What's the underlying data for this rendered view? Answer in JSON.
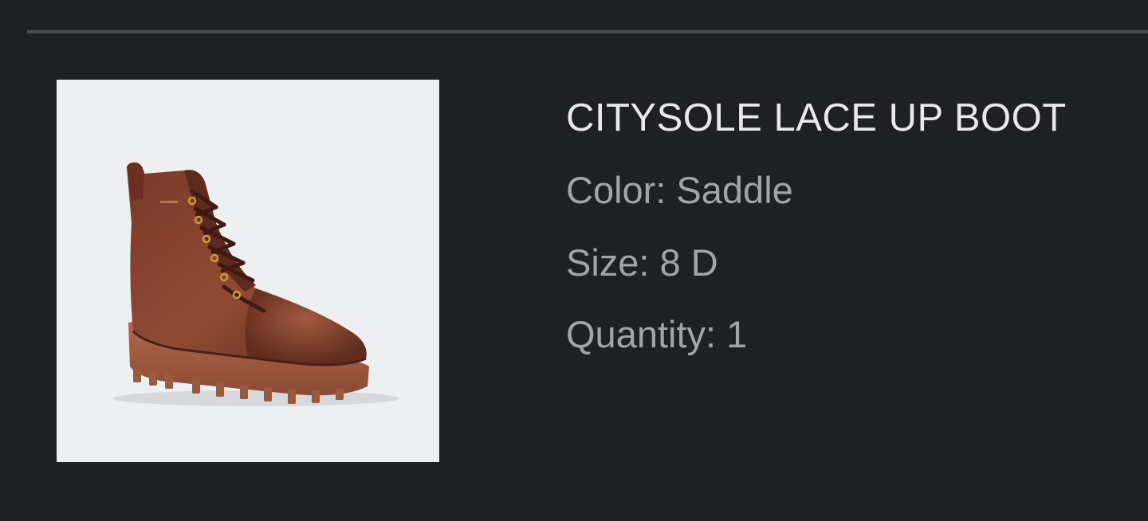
{
  "product": {
    "name": "CITYSOLE LACE UP BOOT",
    "color_text": "Color: Saddle",
    "size_text": "Size: 8 D",
    "quantity_text": "Quantity: 1",
    "image_icon": "boot-image"
  },
  "colors": {
    "background": "#1f2024",
    "divider": "#4a4b4f",
    "title": "#e9e9ea",
    "meta": "#a3a4a8",
    "image_bg": "#eeeff0"
  }
}
